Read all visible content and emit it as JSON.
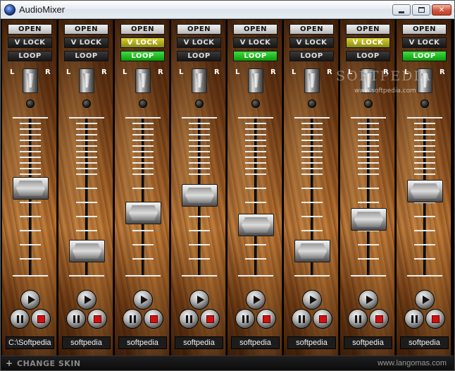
{
  "window": {
    "title": "AudioMixer"
  },
  "labels": {
    "open": "OPEN",
    "vlock": "V LOCK",
    "loop": "LOOP",
    "pan_left": "L",
    "pan_right": "R"
  },
  "channels": [
    {
      "vlock_on": false,
      "loop_on": false,
      "pan": 0.5,
      "level": 0.56,
      "name": "C:\\Softpedia"
    },
    {
      "vlock_on": false,
      "loop_on": false,
      "pan": 0.5,
      "level": 0.1,
      "name": "softpedia"
    },
    {
      "vlock_on": true,
      "loop_on": true,
      "pan": 0.5,
      "level": 0.38,
      "name": "softpedia"
    },
    {
      "vlock_on": false,
      "loop_on": false,
      "pan": 0.5,
      "level": 0.51,
      "name": "softpedia"
    },
    {
      "vlock_on": false,
      "loop_on": true,
      "pan": 0.5,
      "level": 0.29,
      "name": "softpedia"
    },
    {
      "vlock_on": false,
      "loop_on": false,
      "pan": 0.5,
      "level": 0.1,
      "name": "softpedia"
    },
    {
      "vlock_on": true,
      "loop_on": false,
      "pan": 0.5,
      "level": 0.33,
      "name": "softpedia"
    },
    {
      "vlock_on": false,
      "loop_on": true,
      "pan": 0.5,
      "level": 0.54,
      "name": "softpedia"
    }
  ],
  "watermark": {
    "brand": "SOFTPEDIA",
    "url": "www.softpedia.com"
  },
  "footer": {
    "change_skin": "CHANGE SKIN",
    "credit": "www.langomas.com"
  },
  "colors": {
    "vlock_active": "#d8d030",
    "loop_active": "#20c020",
    "stop_red": "#d01010"
  }
}
